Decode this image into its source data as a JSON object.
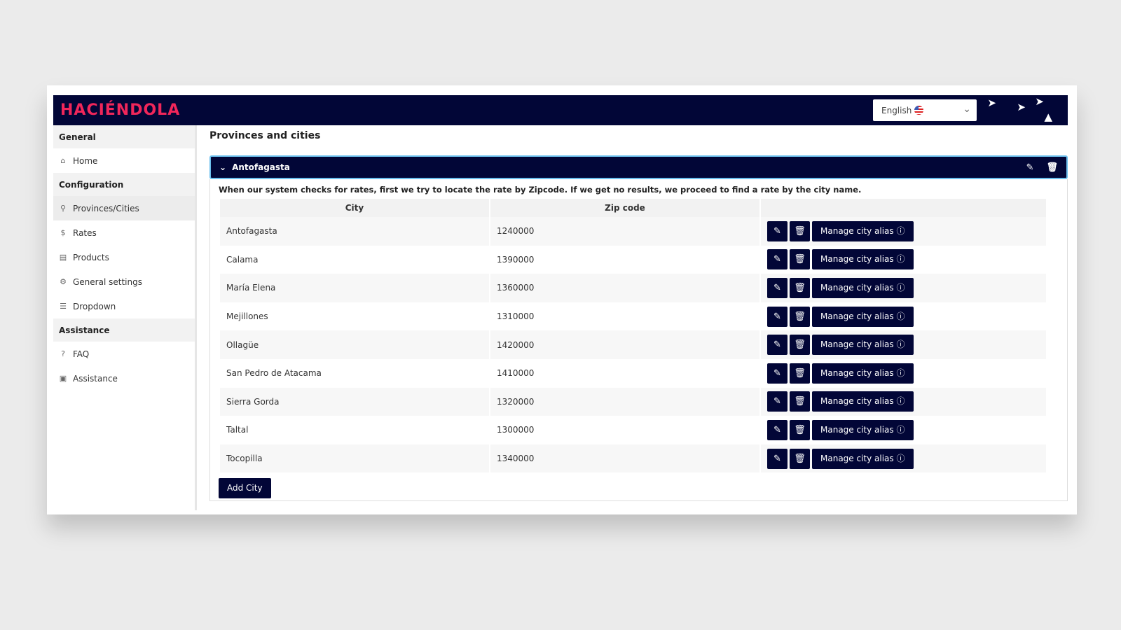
{
  "header": {
    "logo": "HACIÉNDOLA",
    "language": "English"
  },
  "sidebar": {
    "sections": [
      {
        "title": "General",
        "items": [
          {
            "label": "Home",
            "icon": "home-icon",
            "glyph": "⌂"
          }
        ]
      },
      {
        "title": "Configuration",
        "items": [
          {
            "label": "Provinces/Cities",
            "icon": "location-pin-icon",
            "glyph": "⚲",
            "active": true
          },
          {
            "label": "Rates",
            "icon": "dollar-icon",
            "glyph": "$"
          },
          {
            "label": "Products",
            "icon": "box-icon",
            "glyph": "▤"
          },
          {
            "label": "General settings",
            "icon": "gear-icon",
            "glyph": "⚙"
          },
          {
            "label": "Dropdown",
            "icon": "list-icon",
            "glyph": "☰"
          }
        ]
      },
      {
        "title": "Assistance",
        "items": [
          {
            "label": "FAQ",
            "icon": "question-icon",
            "glyph": "?"
          },
          {
            "label": "Assistance",
            "icon": "briefcase-icon",
            "glyph": "▣"
          }
        ]
      }
    ]
  },
  "main": {
    "title": "Provinces and cities",
    "province": "Antofagasta",
    "description": "When our system checks for rates, first we try to locate the rate by Zipcode. If we get no results, we proceed to find a rate by the city name.",
    "columns": [
      "City",
      "Zip code",
      ""
    ],
    "rows": [
      [
        "Antofagasta",
        "1240000"
      ],
      [
        "Calama",
        "1390000"
      ],
      [
        "María Elena",
        "1360000"
      ],
      [
        "Mejillones",
        "1310000"
      ],
      [
        "Ollagüe",
        "1420000"
      ],
      [
        "San Pedro de Atacama",
        "1410000"
      ],
      [
        "Sierra Gorda",
        "1320000"
      ],
      [
        "Taltal",
        "1300000"
      ],
      [
        "Tocopilla",
        "1340000"
      ]
    ],
    "alias_label": "Manage city alias",
    "add_label": "Add City"
  },
  "colors": {
    "navy": "#020637",
    "brand": "#f0265a",
    "focus": "#6cc0ee"
  }
}
